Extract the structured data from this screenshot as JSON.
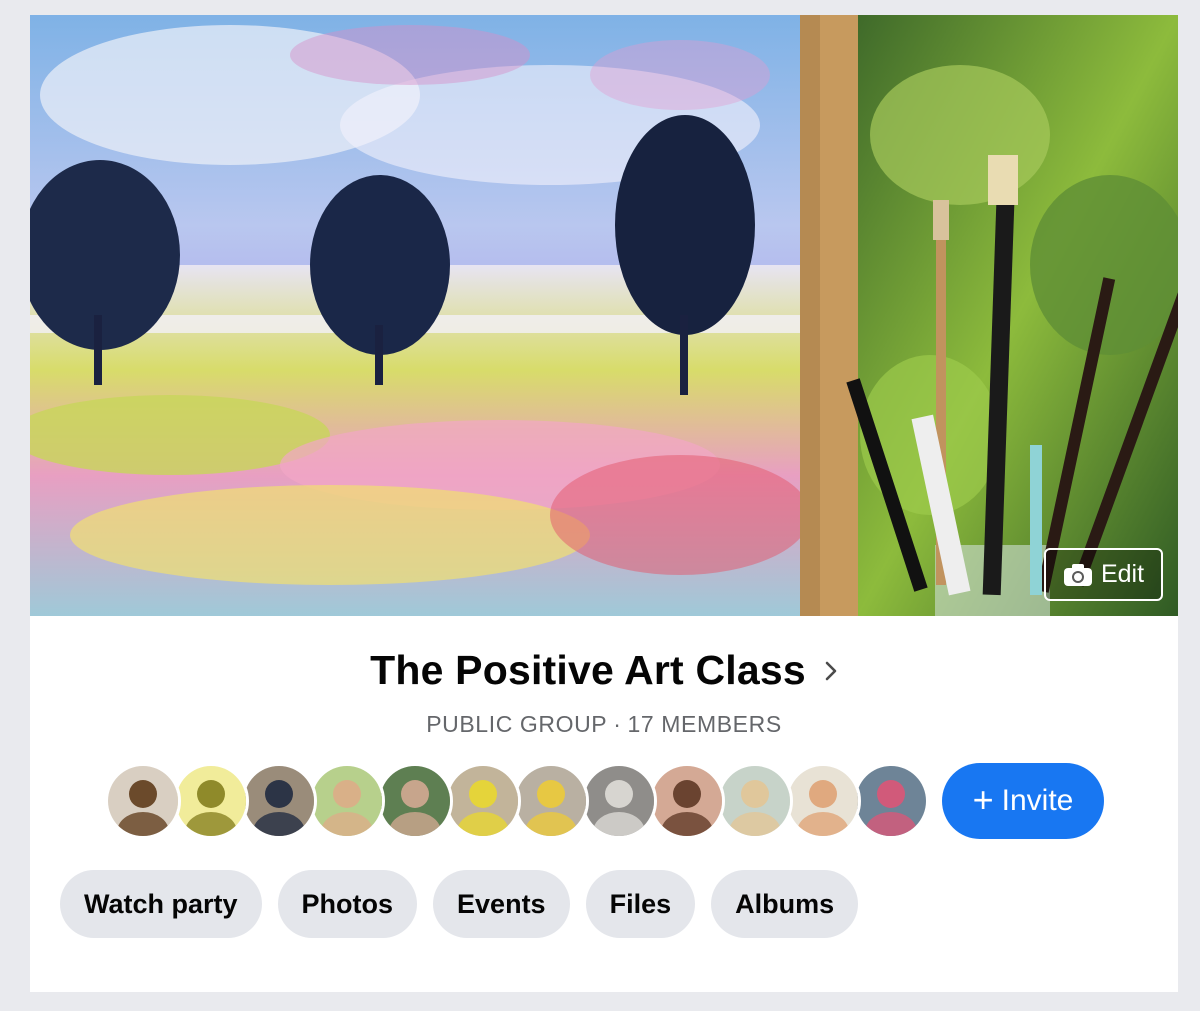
{
  "group": {
    "title": "The Positive Art Class",
    "privacy": "PUBLIC GROUP",
    "separator": "·",
    "member_count": "17 MEMBERS"
  },
  "cover": {
    "edit_label": "Edit",
    "edit_icon": "camera-icon"
  },
  "members": {
    "avatars": [
      {
        "name": "avatar-dog",
        "bg": "#d9cfc2",
        "fg": "#6b4a2b"
      },
      {
        "name": "avatar-flower",
        "bg": "#f1ec9a",
        "fg": "#8f8a2a"
      },
      {
        "name": "avatar-couple-suits",
        "bg": "#9a8c7a",
        "fg": "#2c3446"
      },
      {
        "name": "avatar-woman-hat",
        "bg": "#b7d08c",
        "fg": "#d9b088"
      },
      {
        "name": "avatar-couple-outdoor",
        "bg": "#5e7f52",
        "fg": "#c7a58c"
      },
      {
        "name": "avatar-woman-yellow",
        "bg": "#c2b49a",
        "fg": "#e5d43a"
      },
      {
        "name": "avatar-older-couple",
        "bg": "#b9b0a2",
        "fg": "#e7c843"
      },
      {
        "name": "avatar-cat",
        "bg": "#8f8d8a",
        "fg": "#d7d5d0"
      },
      {
        "name": "avatar-woman-brunette",
        "bg": "#d4a995",
        "fg": "#6a4330"
      },
      {
        "name": "avatar-woman-blonde",
        "bg": "#c7d3c9",
        "fg": "#e0c79b"
      },
      {
        "name": "avatar-family",
        "bg": "#e8e2d5",
        "fg": "#e0a97f"
      },
      {
        "name": "avatar-man-fish",
        "bg": "#6e8497",
        "fg": "#d15a7a"
      }
    ],
    "invite_plus": "+",
    "invite_label": "Invite"
  },
  "tabs": [
    {
      "id": "watch-party",
      "label": "Watch party"
    },
    {
      "id": "photos",
      "label": "Photos"
    },
    {
      "id": "events",
      "label": "Events"
    },
    {
      "id": "files",
      "label": "Files"
    },
    {
      "id": "albums",
      "label": "Albums"
    }
  ],
  "colors": {
    "accent": "#1877f2",
    "page_bg": "#e9eaee",
    "tab_bg": "#e4e6eb",
    "subtitle": "#65676b"
  }
}
